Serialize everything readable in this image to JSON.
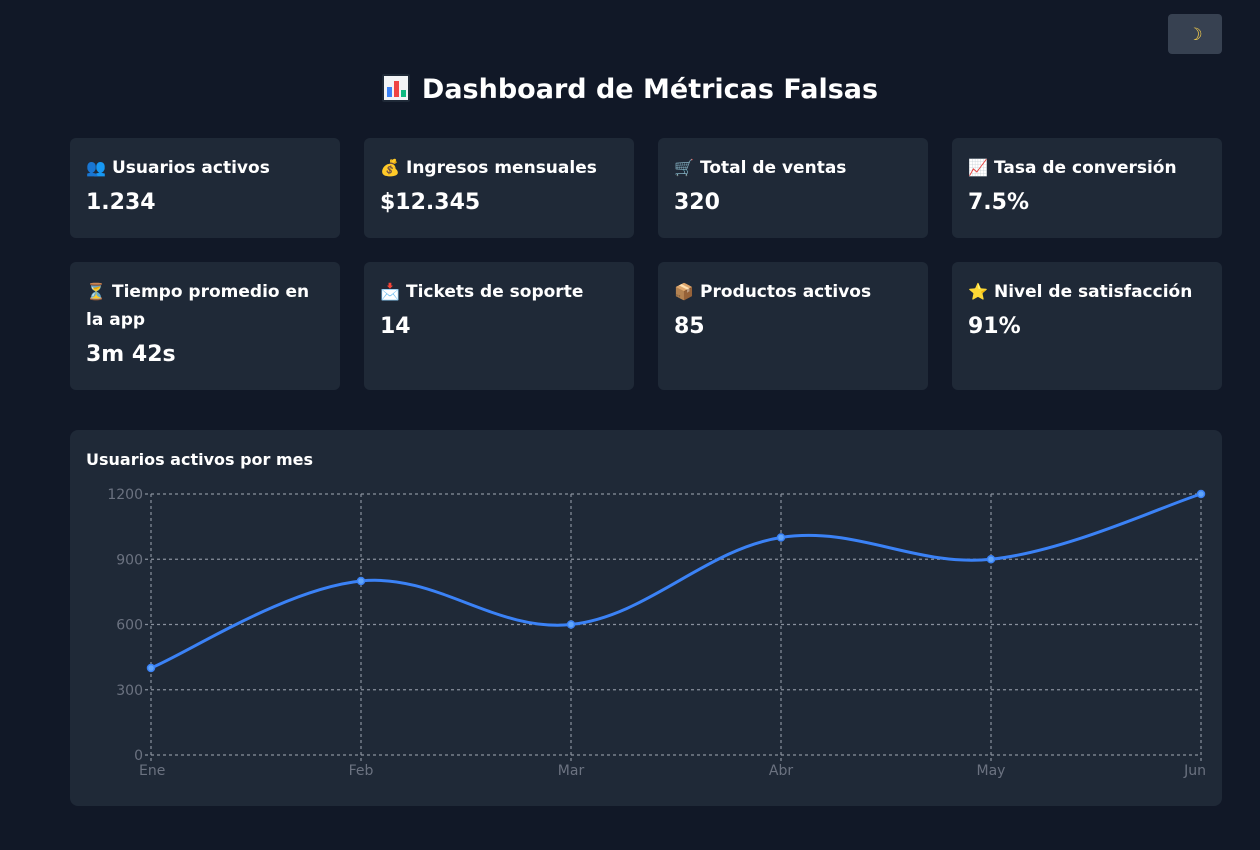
{
  "header": {
    "title": "Dashboard de Métricas Falsas",
    "title_icon": "bar-chart-icon",
    "theme_toggle_icon": "moon-icon",
    "theme_toggle_glyph": "☽"
  },
  "colors": {
    "background": "#111827",
    "card": "#1f2937",
    "accent": "#3b82f6",
    "grid": "#9ca3af",
    "tick": "#6b7280"
  },
  "cards": [
    {
      "icon": "users-icon",
      "glyph": "👥",
      "label": "Usuarios activos",
      "value": "1.234"
    },
    {
      "icon": "money-bag-icon",
      "glyph": "💰",
      "label": "Ingresos mensuales",
      "value": "$12.345"
    },
    {
      "icon": "cart-icon",
      "glyph": "🛒",
      "label": "Total de ventas",
      "value": "320"
    },
    {
      "icon": "trend-up-icon",
      "glyph": "📈",
      "label": "Tasa de conversión",
      "value": "7.5%"
    },
    {
      "icon": "hourglass-icon",
      "glyph": "⏳",
      "label": "Tiempo promedio en la app",
      "value": "3m 42s"
    },
    {
      "icon": "inbox-icon",
      "glyph": "📩",
      "label": "Tickets de soporte",
      "value": "14"
    },
    {
      "icon": "package-icon",
      "glyph": "📦",
      "label": "Productos activos",
      "value": "85"
    },
    {
      "icon": "star-icon",
      "glyph": "⭐",
      "label": "Nivel de satisfacción",
      "value": "91%"
    }
  ],
  "chart_data": {
    "type": "line",
    "title": "Usuarios activos por mes",
    "categories": [
      "Ene",
      "Feb",
      "Mar",
      "Abr",
      "May",
      "Jun"
    ],
    "values": [
      400,
      800,
      600,
      1000,
      900,
      1200
    ],
    "ylim": [
      0,
      1200
    ],
    "yticks": [
      0,
      300,
      600,
      900,
      1200
    ],
    "xlabel": "",
    "ylabel": "",
    "grid": true,
    "line_color": "#3b82f6"
  }
}
